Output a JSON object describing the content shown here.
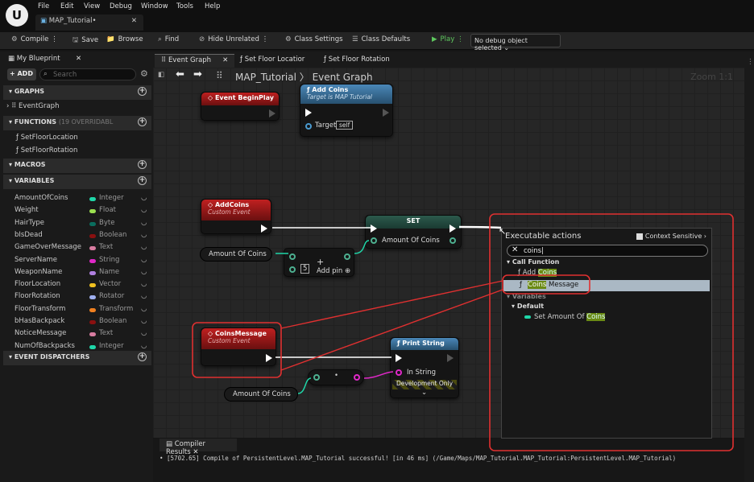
{
  "menu": [
    "File",
    "Edit",
    "View",
    "Debug",
    "Window",
    "Tools",
    "Help"
  ],
  "doc_tab": "MAP_Tutorial•",
  "toolbar": {
    "compile": "Compile",
    "save": "Save",
    "browse": "Browse",
    "find": "Find",
    "hide_unrelated": "Hide Unrelated",
    "class_settings": "Class Settings",
    "class_defaults": "Class Defaults",
    "play": "Play",
    "debug_select": "No debug object selected"
  },
  "left": {
    "tab": "My Blueprint",
    "add": "+ ADD",
    "search_placeholder": "Search",
    "graphs": "GRAPHS",
    "event_graph": "EventGraph",
    "functions": "FUNCTIONS",
    "functions_count": "(19 OVERRIDABL",
    "fn_items": [
      "SetFloorLocation",
      "SetFloorRotation"
    ],
    "macros": "MACROS",
    "variables": "VARIABLES",
    "dispatchers": "EVENT DISPATCHERS",
    "vars": [
      {
        "name": "AmountOfCoins",
        "type": "Integer",
        "color": "#1fd6a8"
      },
      {
        "name": "Weight",
        "type": "Float",
        "color": "#9be050"
      },
      {
        "name": "HairType",
        "type": "Byte",
        "color": "#0a6e5e"
      },
      {
        "name": "bIsDead",
        "type": "Boolean",
        "color": "#8a1010"
      },
      {
        "name": "GameOverMessage",
        "type": "Text",
        "color": "#d87ca0"
      },
      {
        "name": "ServerName",
        "type": "String",
        "color": "#e028c8"
      },
      {
        "name": "WeaponName",
        "type": "Name",
        "color": "#b080e0"
      },
      {
        "name": "FloorLocation",
        "type": "Vector",
        "color": "#f0c020"
      },
      {
        "name": "FloorRotation",
        "type": "Rotator",
        "color": "#a0b0f0"
      },
      {
        "name": "FloorTransform",
        "type": "Transform",
        "color": "#f08020"
      },
      {
        "name": "bHasBackpack",
        "type": "Boolean",
        "color": "#8a1010"
      },
      {
        "name": "NoticeMessage",
        "type": "Text",
        "color": "#d87ca0"
      },
      {
        "name": "NumOfBackpacks",
        "type": "Integer",
        "color": "#1fd6a8"
      }
    ]
  },
  "graph_tabs": [
    "Event Graph",
    "Set Floor Locatior",
    "Set Floor Rotation"
  ],
  "breadcrumb": {
    "root": "MAP_Tutorial",
    "sep": "〉",
    "leaf": "Event Graph"
  },
  "zoom": "Zoom 1:1",
  "nodes": {
    "begin_play": "Event BeginPlay",
    "add_coins_fn": "Add Coins",
    "add_coins_target": "Target is MAP Tutorial",
    "target": "Target",
    "self": "self",
    "addcoins_event": "AddCoins",
    "custom_event": "Custom Event",
    "set": "SET",
    "amount_of_coins": "Amount Of Coins",
    "add_pin": "Add pin",
    "add_val": "5",
    "coins_message_event": "CoinsMessage",
    "custom_event2": "Custom Event",
    "print_string": "Print String",
    "in_string": "In String",
    "dev_only": "Development Only",
    "amount_of_coins2": "Amount Of Coins",
    "amount_of_coins3": "Amount Of Coins"
  },
  "popup": {
    "title": "Executable actions",
    "context": "Context Sensitive",
    "query": "coins",
    "call_function": "Call Function",
    "add_coins_pre": "Add ",
    "add_coins_hl": "Coins",
    "coins_msg_hl": "Coins",
    "coins_msg_post": " Message",
    "variables": "Variables",
    "default": "Default",
    "set_amount_pre": "Set Amount Of ",
    "set_amount_hl": "Coins"
  },
  "compiler": {
    "tab": "Compiler Results",
    "log": "• [5702.65] Compile of PersistentLevel.MAP_Tutorial successful! [in 46 ms] (/Game/Maps/MAP_Tutorial.MAP_Tutorial:PersistentLevel.MAP_Tutorial)"
  },
  "colors": {
    "annotation": "#e03030",
    "exec_wire": "#ffffff",
    "int_pin": "#1fd6a8"
  }
}
